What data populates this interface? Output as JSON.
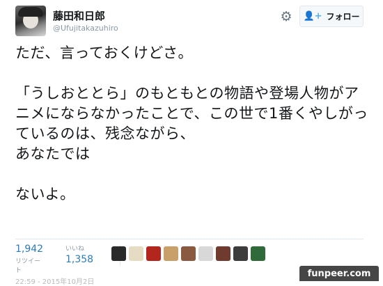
{
  "profile": {
    "name": "藤田和日郎",
    "handle": "@Ufujitakazuhiro"
  },
  "actions": {
    "gear_icon": "gear-icon",
    "follow_label": "フォロー"
  },
  "tweet": {
    "text": "ただ、言っておくけどさ。\n\n「うしおととら」のもともとの物語や登場人物がアニメにならなかったことで、この世で1番くやしがっているのは、残念ながら、\nあなたでは\n\nないよ。"
  },
  "stats": {
    "retweets": "1,942",
    "retweets_label": "リツイート",
    "likes_label": "いいね",
    "likes": "1,358"
  },
  "likers": [
    {
      "color": "#2a2a2a"
    },
    {
      "color": "#e6dcc4"
    },
    {
      "color": "#b3261e"
    },
    {
      "color": "#c9a06a"
    },
    {
      "color": "#8a5a40"
    },
    {
      "color": "#d8d8d8"
    },
    {
      "color": "#6e3b2e"
    },
    {
      "color": "#3d3d3d"
    },
    {
      "color": "#2f6b3a"
    }
  ],
  "watermark": "funpeer.com",
  "meta": "22:59 - 2015年10月2日"
}
